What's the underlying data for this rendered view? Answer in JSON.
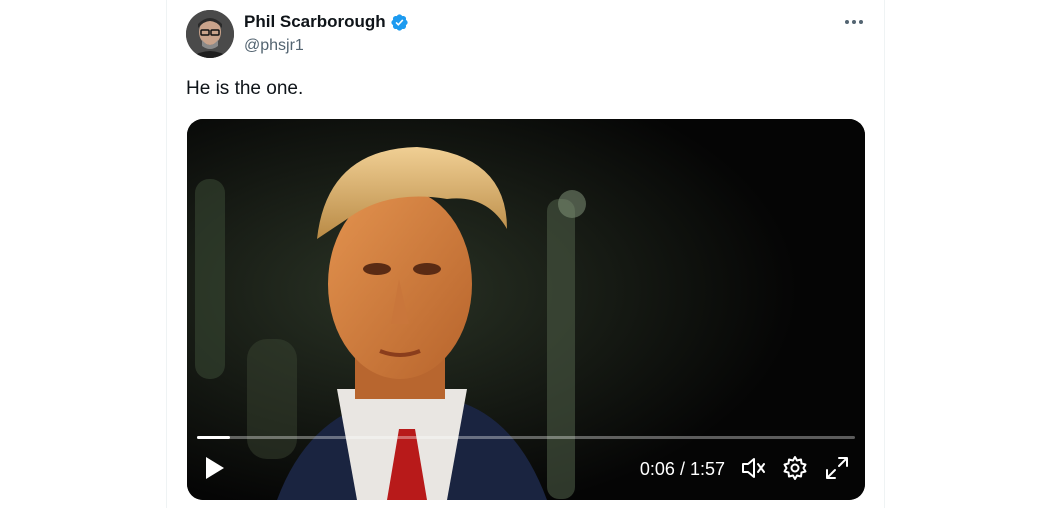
{
  "post": {
    "author_name": "Phil Scarborough",
    "author_handle": "@phsjr1",
    "text": "He is the one."
  },
  "video": {
    "current_time": "0:06",
    "separator": "/",
    "duration": "1:57",
    "progress_fraction": 0.05
  },
  "icons": {
    "verified": "verified-badge-icon",
    "more": "more-options-icon",
    "play": "play-icon",
    "mute": "volume-muted-icon",
    "settings": "gear-icon",
    "fullscreen": "fullscreen-icon"
  },
  "colors": {
    "verified_blue": "#1d9bf0",
    "handle_gray": "#536471",
    "text": "#0f1419"
  }
}
